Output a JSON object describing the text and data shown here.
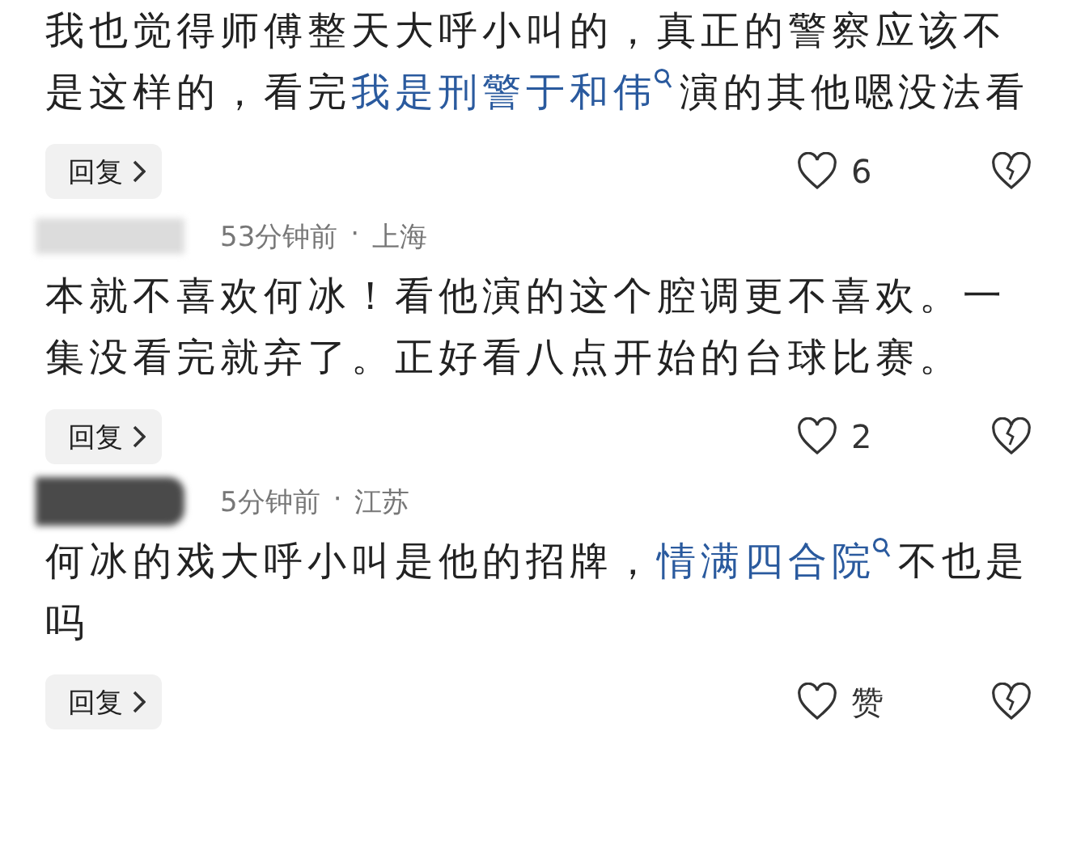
{
  "comments": [
    {
      "text": [
        {
          "kind": "text",
          "text": "我也觉得师傅整天大呼小叫的，真正的警察应该不是这样的，看完"
        },
        {
          "kind": "link",
          "text": "我是刑警于和伟"
        },
        {
          "kind": "text",
          "text": "演的其他嗯没法看"
        }
      ],
      "reply": "回复",
      "likes": "6"
    },
    {
      "header": {
        "blur_dark": false,
        "time": "53分钟前",
        "separator": "·",
        "location": "上海"
      },
      "text": [
        {
          "kind": "text",
          "text": "本就不喜欢何冰！看他演的这个腔调更不喜欢。一集没看完就弃了。正好看八点开始的台球比赛。"
        }
      ],
      "reply": "回复",
      "likes": "2"
    },
    {
      "header": {
        "blur_dark": true,
        "time": "5分钟前",
        "separator": "·",
        "location": "江苏"
      },
      "text": [
        {
          "kind": "text",
          "text": "何冰的戏大呼小叫是他的招牌，"
        },
        {
          "kind": "link",
          "text": "情满四合院"
        },
        {
          "kind": "text",
          "text": "不也是吗"
        }
      ],
      "reply": "回复",
      "likes": "赞"
    }
  ]
}
